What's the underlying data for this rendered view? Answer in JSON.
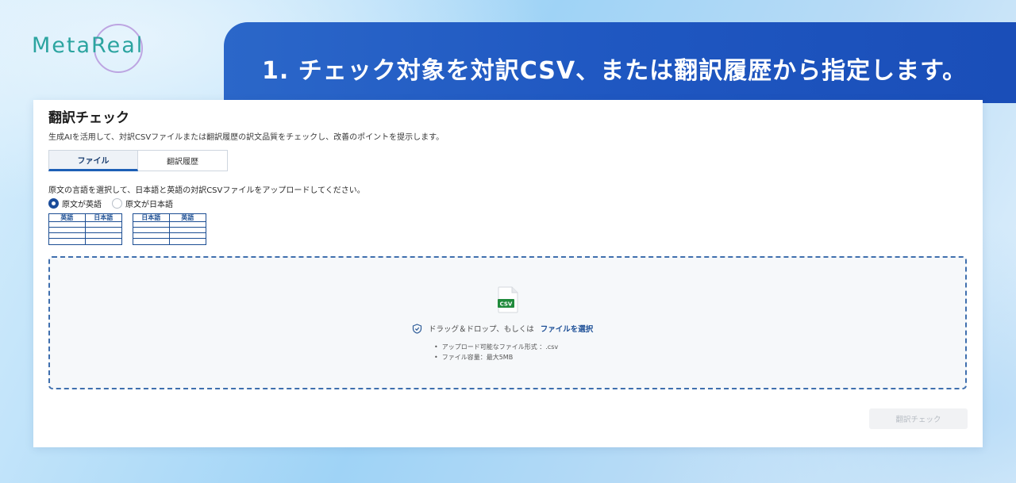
{
  "logo": {
    "text": "MetaReal"
  },
  "banner": {
    "title": "1. チェック対象を対訳CSV、または翻訳履歴から指定します。"
  },
  "page": {
    "title": "翻訳チェック",
    "description": "生成AIを活用して、対訳CSVファイルまたは翻訳履歴の訳文品質をチェックし、改善のポイントを提示します。"
  },
  "tabs": [
    {
      "label": "ファイル",
      "active": true
    },
    {
      "label": "翻訳履歴",
      "active": false
    }
  ],
  "instruction": "原文の言語を選択して、日本語と英語の対訳CSVファイルをアップロードしてください。",
  "radios": [
    {
      "label": "原文が英語",
      "checked": true
    },
    {
      "label": "原文が日本語",
      "checked": false
    }
  ],
  "mini_tables": [
    {
      "col1": "英語",
      "col2": "日本語"
    },
    {
      "col1": "日本語",
      "col2": "英語"
    }
  ],
  "dropzone": {
    "file_badge": "CSV",
    "prompt": "ドラッグ＆ドロップ、もしくは",
    "link": "ファイルを選択",
    "notes": [
      "アップロード可能なファイル形式 ：.csv",
      "ファイル容量：最大5MB"
    ]
  },
  "submit": {
    "label": "翻訳チェック",
    "enabled": false
  },
  "colors": {
    "accent": "#1d5fb6",
    "banner": "#2360c4",
    "logo": "#2ba4a0"
  }
}
